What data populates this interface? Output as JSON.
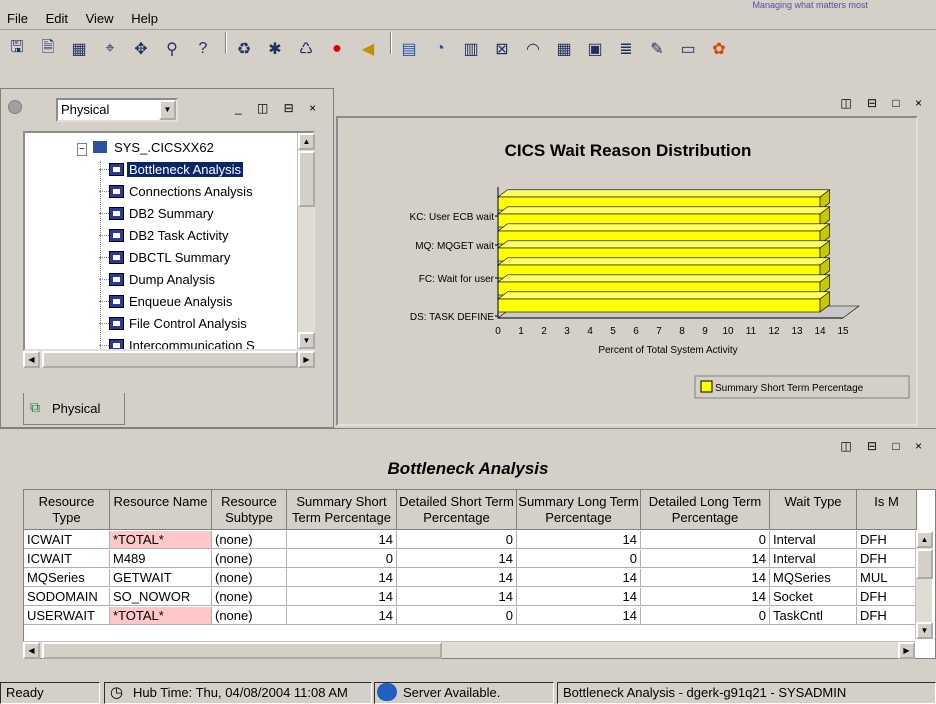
{
  "menubar": {
    "items": [
      "File",
      "Edit",
      "View",
      "Help"
    ],
    "top_note": "Managing what matters most"
  },
  "toolbar": {
    "icons": [
      "save-icon",
      "properties-icon",
      "view-icon",
      "find-icon",
      "network-icon",
      "binoculars-icon",
      "help-icon",
      "refresh-icon",
      "history-icon",
      "recycle-icon",
      "stop-icon",
      "speaker-icon",
      "table-icon",
      "pie-chart-icon",
      "bar-chart-icon",
      "plot-chart-icon",
      "gauge-icon",
      "grid-icon",
      "notepad-icon",
      "editor-icon",
      "pen-icon",
      "terminal-icon",
      "color-icon"
    ]
  },
  "navigator": {
    "view_select": "Physical",
    "window_controls": "_ ◫ ⊟ ×",
    "root_node": "SYS_.CICSXX62",
    "items": [
      "Bottleneck Analysis",
      "Connections Analysis",
      "DB2 Summary",
      "DB2 Task Activity",
      "DBCTL Summary",
      "Dump Analysis",
      "Enqueue Analysis",
      "File Control Analysis",
      "Intercommunication S"
    ],
    "selected_index": 0,
    "tab_label": "Physical"
  },
  "chart_panel": {
    "window_controls": "◫ ⊟ □ ×"
  },
  "chart_data": {
    "type": "bar",
    "orientation": "horizontal",
    "title": "CICS Wait Reason Distribution",
    "xlabel": "Percent of Total System Activity",
    "ylabel": "",
    "xlim": [
      0,
      15
    ],
    "x_ticks": [
      "0",
      "1",
      "2",
      "3",
      "4",
      "5",
      "6",
      "7",
      "8",
      "9",
      "10",
      "11",
      "12",
      "13",
      "14",
      "15"
    ],
    "category_labels": [
      "KC: User ECB wait",
      "MQ: MQGET wait",
      "FC: Wait for user",
      "DS: TASK DEFINE"
    ],
    "series": [
      {
        "name": "Summary Short Term Percentage",
        "values": [
          14,
          14,
          14,
          14,
          14,
          14,
          14
        ],
        "color": "#ffff00"
      }
    ],
    "legend": "bottom-right",
    "grid": false
  },
  "table_panel": {
    "window_controls": "◫ ⊟ □ ×",
    "title": "Bottleneck Analysis",
    "columns": [
      "Resource Type",
      "Resource Name",
      "Resource Subtype",
      "Summary Short Term Percentage",
      "Detailed Short Term Percentage",
      "Summary Long Term Percentage",
      "Detailed Long Term Percentage",
      "Wait Type",
      "Is M"
    ],
    "rows": [
      [
        "ICWAIT",
        "*TOTAL*",
        "(none)",
        "14",
        "0",
        "14",
        "0",
        "Interval",
        "DFH"
      ],
      [
        "ICWAIT",
        "M489",
        "(none)",
        "0",
        "14",
        "0",
        "14",
        "Interval",
        "DFH"
      ],
      [
        "MQSeries",
        "GETWAIT",
        "(none)",
        "14",
        "14",
        "14",
        "14",
        "MQSeries",
        "MUL"
      ],
      [
        "SODOMAIN",
        "SO_NOWOR",
        "(none)",
        "14",
        "14",
        "14",
        "14",
        "Socket",
        "DFH"
      ],
      [
        "USERWAIT",
        "*TOTAL*",
        "(none)",
        "14",
        "0",
        "14",
        "0",
        "TaskCntl",
        "DFH"
      ]
    ],
    "pink_rows": [
      0,
      4
    ]
  },
  "statusbar": {
    "ready": "Ready",
    "hub_time": "Hub Time: Thu, 04/08/2004 11:08 AM",
    "server": "Server Available.",
    "workspace": "Bottleneck Analysis - dgerk-g91q21 - SYSADMIN"
  }
}
